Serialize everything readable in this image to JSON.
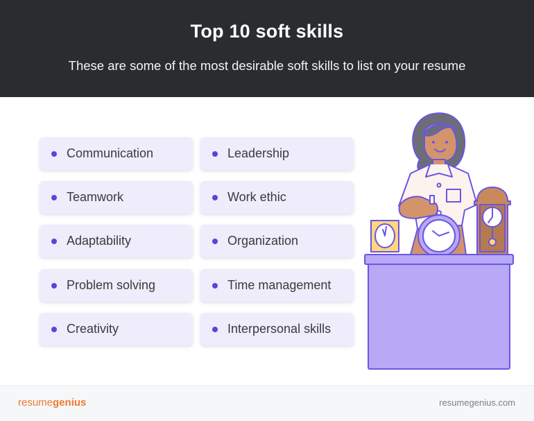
{
  "header": {
    "title": "Top 10 soft skills",
    "subtitle": "These are some of the most desirable soft skills to list on your resume"
  },
  "skills": [
    {
      "label": "Communication"
    },
    {
      "label": "Leadership"
    },
    {
      "label": "Teamwork"
    },
    {
      "label": "Work ethic"
    },
    {
      "label": "Adaptability"
    },
    {
      "label": "Organization"
    },
    {
      "label": "Problem solving"
    },
    {
      "label": "Time management"
    },
    {
      "label": "Creativity"
    },
    {
      "label": "Interpersonal skills"
    }
  ],
  "illustration": {
    "description": "woman holding a clock behind a purple desk with a small yellow clock and a grandfather clock",
    "icon": "person-with-clocks-illustration"
  },
  "footer": {
    "brand_light": "resume",
    "brand_bold": "genius",
    "site": "resumegenius.com"
  },
  "colors": {
    "header_bg": "#2b2c2f",
    "card_bg": "#efecfb",
    "bullet": "#5b45d9",
    "desk": "#b7a9f5",
    "outline": "#6b55e3",
    "brand": "#ef7b32"
  }
}
